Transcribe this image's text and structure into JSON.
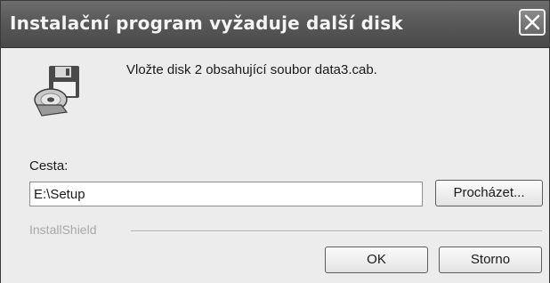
{
  "window": {
    "title": "Instalační program vyžaduje další disk",
    "close_icon": "close-icon"
  },
  "dialog": {
    "icon": "disk-cd-icon",
    "message": "Vložte disk 2 obsahující soubor data3.cab.",
    "path_label": "Cesta:",
    "path_value": "E:\\Setup",
    "browse_label": "Procházet...",
    "brand": "InstallShield",
    "ok_label": "OK",
    "cancel_label": "Storno"
  },
  "colors": {
    "titlebar": "#5a5a5a",
    "client_bg": "#ececec"
  }
}
